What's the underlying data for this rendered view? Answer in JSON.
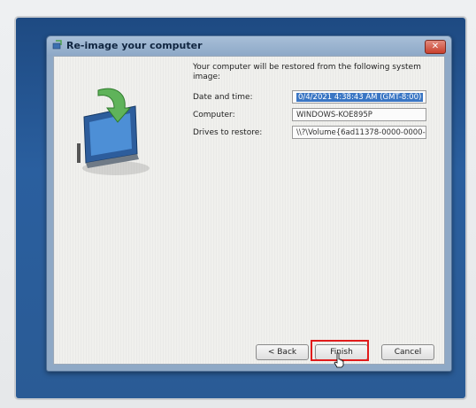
{
  "window": {
    "title": "Re-image your computer",
    "close_glyph": "✕"
  },
  "intro": "Your computer will be restored from the following system image:",
  "fields": [
    {
      "label": "Date and time:",
      "value": "0/4/2021 4:38:43 AM (GMT-8:00)",
      "selected": true
    },
    {
      "label": "Computer:",
      "value": "WINDOWS-KOE895P",
      "selected": false
    },
    {
      "label": "Drives to restore:",
      "value": "\\\\?\\Volume{6ad11378-0000-0000-",
      "selected": false
    }
  ],
  "buttons": {
    "back": "< Back",
    "finish": "Finish",
    "cancel": "Cancel"
  },
  "colors": {
    "highlight": "#e11b1b",
    "selection": "#3a76c4"
  },
  "icons": {
    "title": "restore-icon",
    "hero": "system-image-restore-icon",
    "close": "close-icon",
    "cursor": "hand-pointer-icon"
  }
}
